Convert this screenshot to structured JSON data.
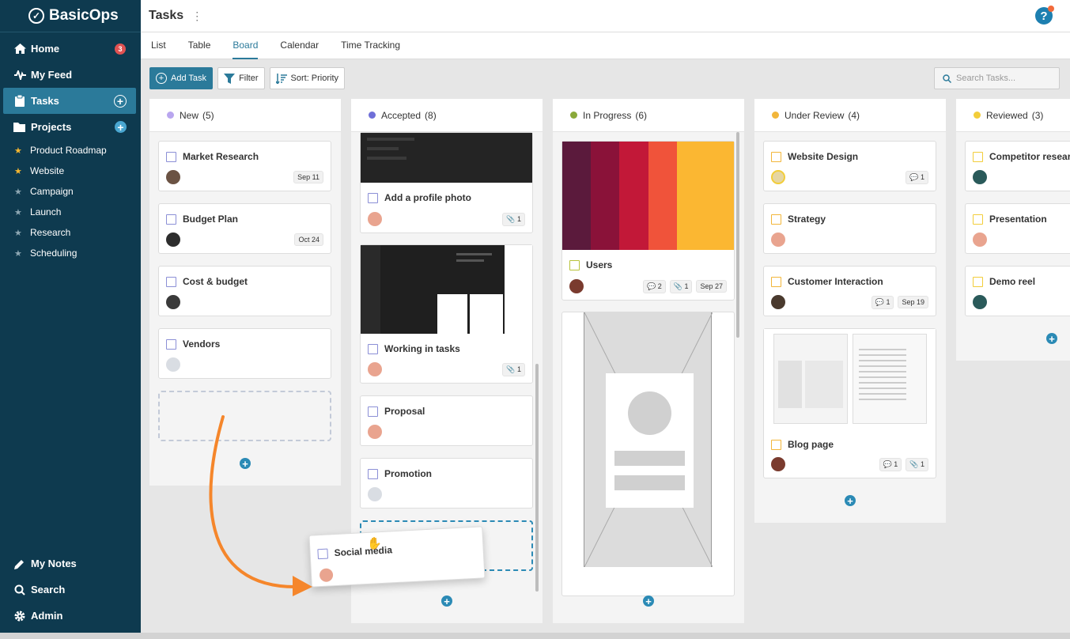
{
  "app": {
    "name": "BasicOps"
  },
  "sidebar": {
    "main": [
      {
        "label": "Home",
        "badge": "3"
      },
      {
        "label": "My Feed"
      },
      {
        "label": "Tasks"
      },
      {
        "label": "Projects"
      }
    ],
    "projects": [
      {
        "label": "Product Roadmap"
      },
      {
        "label": "Website"
      },
      {
        "label": "Campaign"
      },
      {
        "label": "Launch"
      },
      {
        "label": "Research"
      },
      {
        "label": "Scheduling"
      }
    ],
    "bottom": [
      {
        "label": "My Notes"
      },
      {
        "label": "Search"
      },
      {
        "label": "Admin"
      }
    ]
  },
  "header": {
    "title": "Tasks",
    "menu": "⋮",
    "help": "?"
  },
  "tabs": [
    "List",
    "Table",
    "Board",
    "Calendar",
    "Time Tracking"
  ],
  "toolbar": {
    "add": "Add Task",
    "filter": "Filter",
    "sort": "Sort: Priority"
  },
  "search": {
    "placeholder": "Search Tasks..."
  },
  "columns": [
    {
      "name": "New",
      "count": "(5)",
      "color": "#b9a6ef",
      "cards": [
        {
          "name": "Market Research",
          "date": "Sep 11"
        },
        {
          "name": "Budget Plan",
          "date": "Oct 24"
        },
        {
          "name": "Cost & budget"
        },
        {
          "name": "Vendors"
        }
      ]
    },
    {
      "name": "Accepted",
      "count": "(8)",
      "color": "#6f6fd8",
      "cards": [
        {
          "name": "Add a profile photo",
          "attach": "1"
        },
        {
          "name": "Working in tasks",
          "attach": "1"
        },
        {
          "name": "Proposal"
        },
        {
          "name": "Promotion"
        }
      ]
    },
    {
      "name": "In Progress",
      "count": "(6)",
      "color": "#8aa93a",
      "cards": [
        {
          "name": "Users",
          "comments": "2",
          "attach": "1",
          "date": "Sep 27"
        }
      ]
    },
    {
      "name": "Under Review",
      "count": "(4)",
      "color": "#f2b63a",
      "cards": [
        {
          "name": "Website Design",
          "comments": "1"
        },
        {
          "name": "Strategy"
        },
        {
          "name": "Customer Interaction",
          "comments": "1",
          "date": "Sep 19"
        },
        {
          "name": "Blog page",
          "comments": "1",
          "attach": "1"
        }
      ]
    },
    {
      "name": "Reviewed",
      "count": "(3)",
      "color": "#f2cd3a",
      "cards": [
        {
          "name": "Competitor research"
        },
        {
          "name": "Presentation"
        },
        {
          "name": "Demo reel"
        }
      ]
    }
  ],
  "dragging": {
    "name": "Social media"
  },
  "colors": {
    "sidebar": "#0e3a4f",
    "accent": "#2b7a9a",
    "arrow": "#f5862b"
  }
}
